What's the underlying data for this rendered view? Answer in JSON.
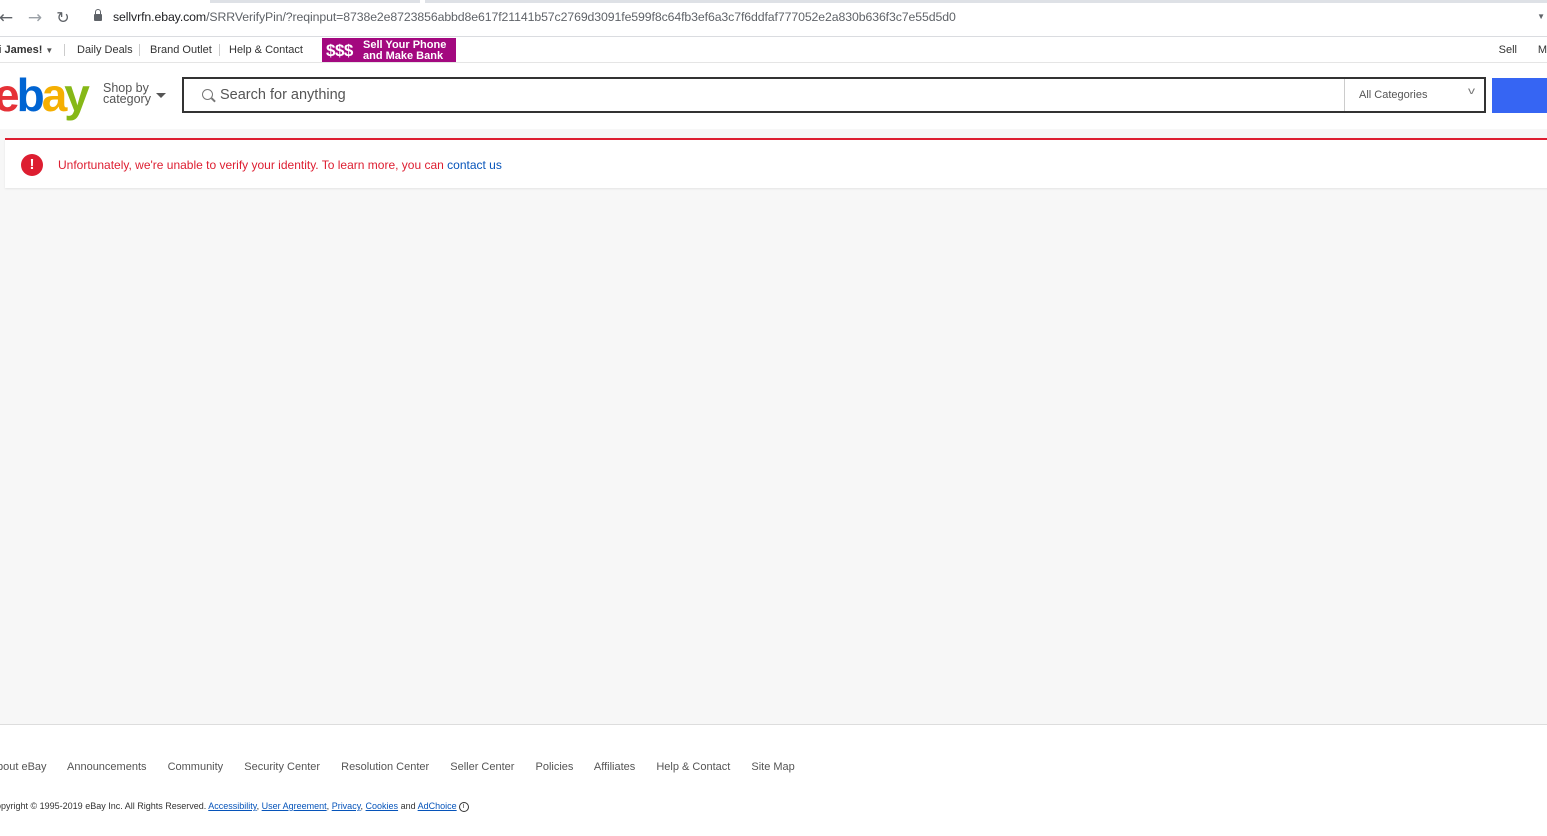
{
  "browser": {
    "url_host": "sellvrfn.ebay.com",
    "url_path": "/SRRVerifyPin/?reqinput=8738e2e8723856abbd8e617f21141b57c2769d3091fe599f8c64fb3ef6a3c7f6ddfaf777052e2a830b636f3c7e55d5d0"
  },
  "topnav": {
    "greeting_prefix": "i ",
    "greeting_name": "James!",
    "daily_deals": "Daily Deals",
    "brand_outlet": "Brand Outlet",
    "help_contact": "Help & Contact",
    "promo_money": "$$$",
    "promo_line1": "Sell Your Phone",
    "promo_line2": "and Make Bank",
    "sell": "Sell",
    "truncated_right": "M"
  },
  "header": {
    "logo": {
      "e": "e",
      "b": "b",
      "a": "a",
      "y": "y"
    },
    "shop_by_line1": "Shop by",
    "shop_by_line2": "category",
    "search_placeholder": "Search for anything",
    "category_selected": "All Categories"
  },
  "alert": {
    "message": "Unfortunately, we're unable to verify your identity. To learn more, you can ",
    "link": "contact us",
    "icon": "!"
  },
  "footer": {
    "links": [
      "bout eBay",
      "Announcements",
      "Community",
      "Security Center",
      "Resolution Center",
      "Seller Center",
      "Policies",
      "Affiliates",
      "Help & Contact",
      "Site Map"
    ],
    "copyright_prefix": "opyright © 1995-2019 eBay Inc. All Rights Reserved.",
    "legal_links": [
      "Accessibility",
      "User Agreement",
      "Privacy",
      "Cookies"
    ],
    "and_word": "and",
    "adchoice": "AdChoice"
  },
  "colors": {
    "ebay_red": "#e53238",
    "ebay_blue": "#0064d2",
    "ebay_yellow": "#f5af02",
    "ebay_green": "#86b817",
    "alert_red": "#dd1e31",
    "search_blue": "#3665f3",
    "promo_magenta": "#a3087f"
  }
}
